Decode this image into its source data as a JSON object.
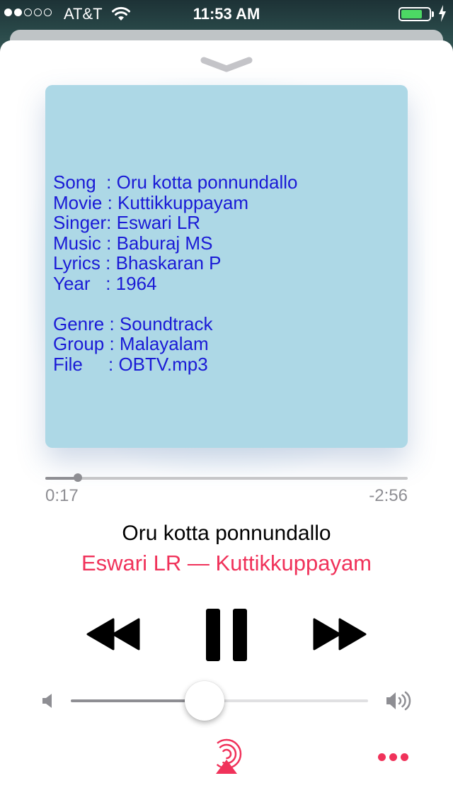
{
  "status_bar": {
    "carrier": "AT&T",
    "time": "11:53 AM",
    "signal_bars_filled": 2,
    "signal_bars_total": 5,
    "battery_level": 0.75,
    "icons": [
      "wifi-icon",
      "battery-icon",
      "charging-bolt-icon"
    ]
  },
  "player": {
    "collapse_icon": "chevron-down-icon",
    "artwork_lines": [
      "Song  : Oru kotta ponnundallo",
      "Movie : Kuttikkuppayam",
      "Singer: Eswari LR",
      "Music : Baburaj MS",
      "Lyrics : Bhaskaran P",
      "Year   : 1964",
      "",
      "Genre : Soundtrack",
      "Group : Malayalam",
      "File     : OBTV.mp3"
    ],
    "progress_fraction": 0.09,
    "elapsed": "0:17",
    "remaining": "-2:56",
    "title": "Oru kotta ponnundallo",
    "subtitle": "Eswari LR — Kuttikkuppayam",
    "volume_fraction": 0.45,
    "controls": {
      "rewind_icon": "rewind-icon",
      "pause_icon": "pause-icon",
      "forward_icon": "fast-forward-icon",
      "volume_low_icon": "volume-low-icon",
      "volume_high_icon": "volume-high-icon",
      "airplay_icon": "airplay-icon",
      "more_icon": "more-icon"
    },
    "colors": {
      "accent": "#f0325a",
      "artwork_bg": "#add8e6",
      "artwork_text": "#1a1ad6"
    }
  }
}
